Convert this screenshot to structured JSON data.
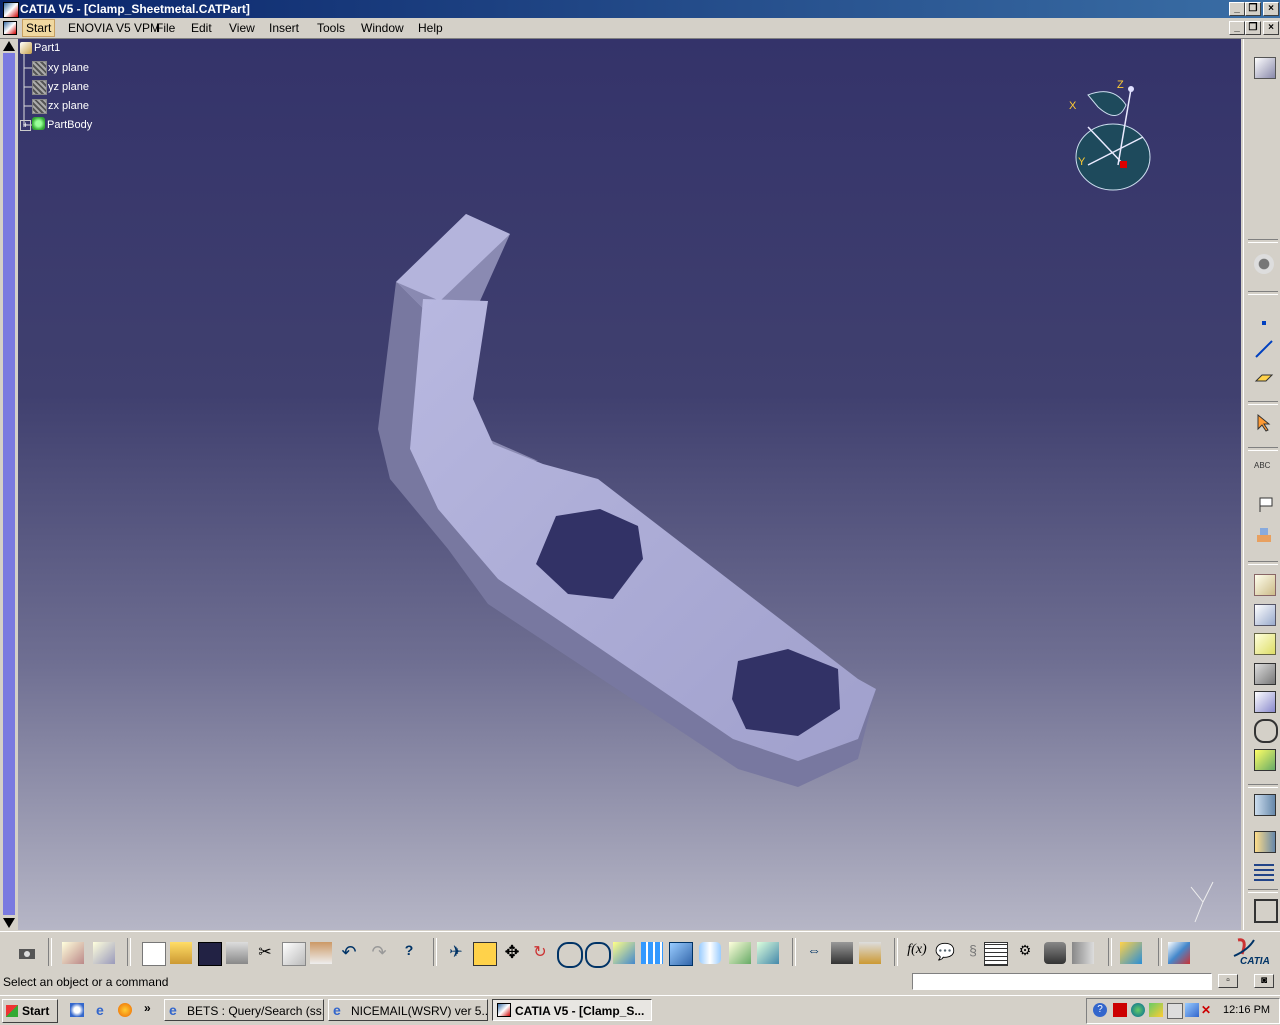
{
  "window": {
    "title": "CATIA V5 - [Clamp_Sheetmetal.CATPart]"
  },
  "menu": {
    "items": [
      "Start",
      "ENOVIA V5 VPM",
      "File",
      "Edit",
      "View",
      "Insert",
      "Tools",
      "Window",
      "Help"
    ]
  },
  "tree": {
    "root": "Part1",
    "items": [
      "xy plane",
      "yz plane",
      "zx plane",
      "PartBody"
    ]
  },
  "compass": {
    "x": "X",
    "y": "Y",
    "z": "Z"
  },
  "status": {
    "prompt": "Select an object or a command",
    "command_input": ""
  },
  "taskbar": {
    "start": "Start",
    "buttons": [
      "BETS : Query/Search (ss...",
      "NICEMAIL(WSRV) ver 5....",
      "CATIA V5 - [Clamp_S..."
    ],
    "clock": "12:16 PM"
  },
  "brand": {
    "logo_text": "CATIA"
  },
  "colors": {
    "title_bar": "#0a246a",
    "viewport_top": "#34336a",
    "viewport_bottom": "#b6b6c6",
    "part": "#a8a8d8",
    "active_menu": "#f0d8a0"
  }
}
